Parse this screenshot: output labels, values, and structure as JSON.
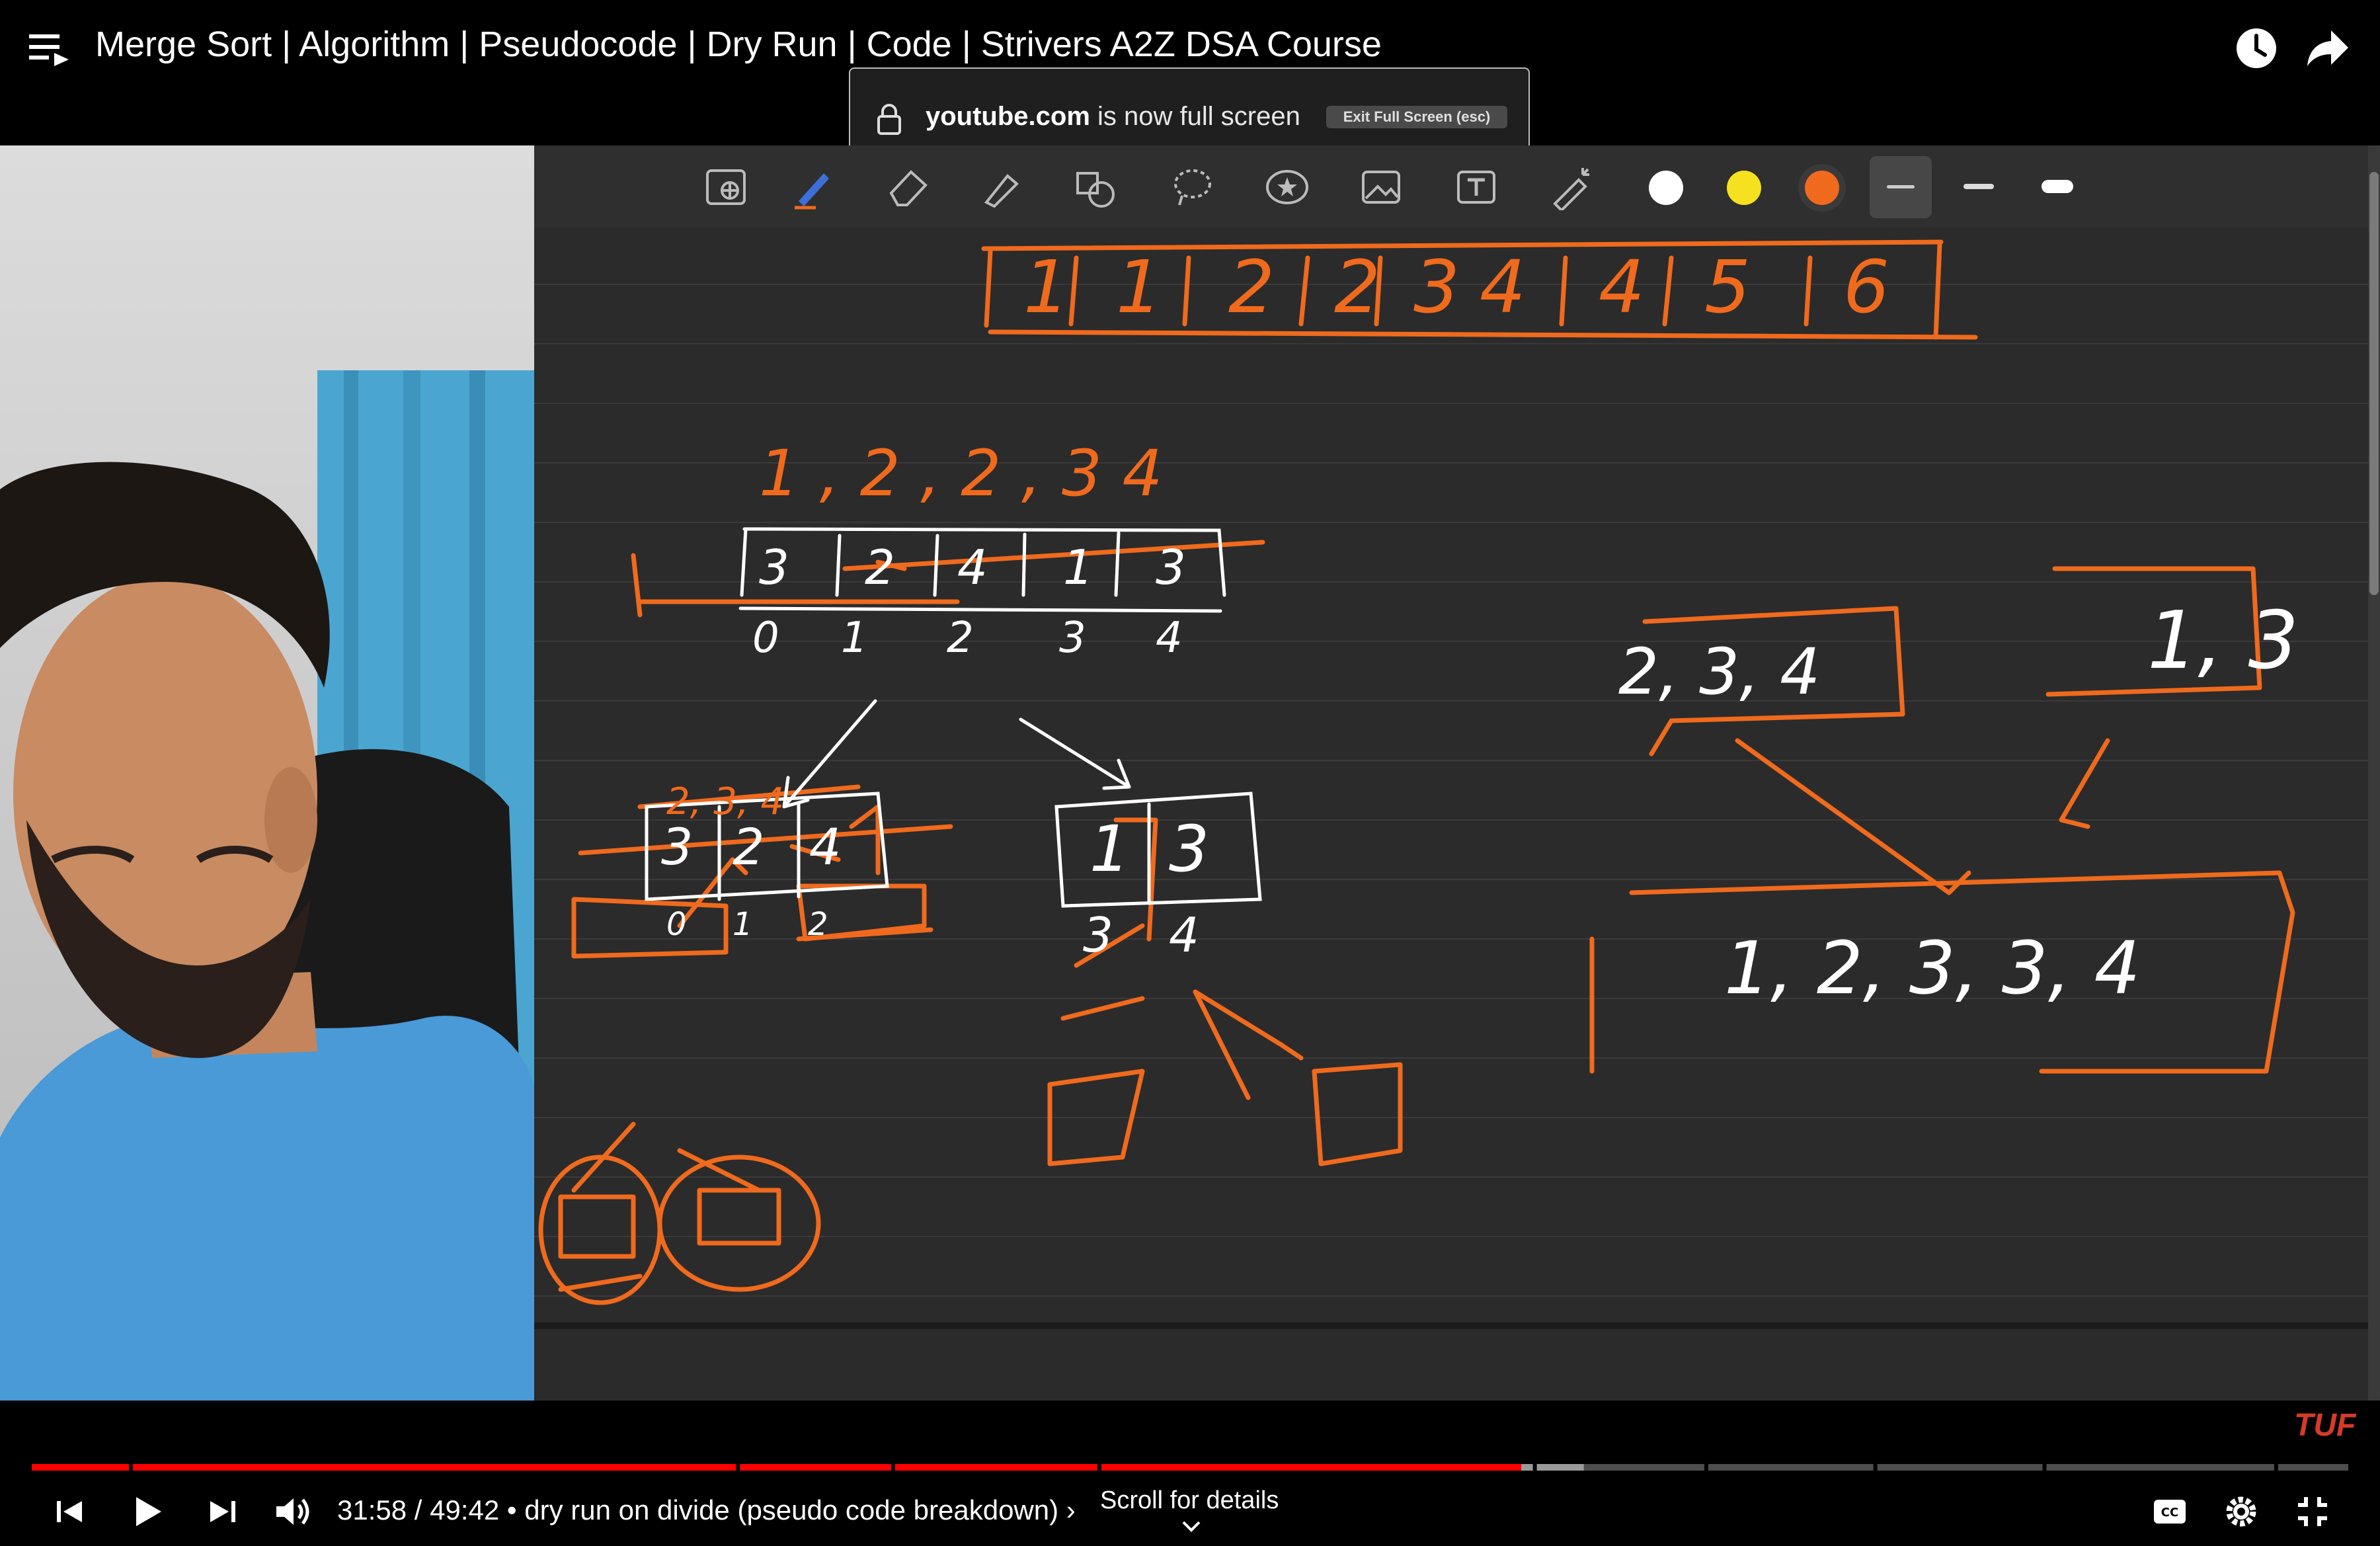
{
  "header": {
    "title": "Merge Sort | Algorithm | Pseudocode | Dry Run | Code | Strivers A2Z DSA Course"
  },
  "fullscreen_notice": {
    "site": "youtube.com",
    "message": "is now full screen",
    "exit_button": "Exit Full Screen (esc)"
  },
  "whiteboard": {
    "merged_row": [
      "1",
      "1",
      "2",
      "2",
      "3",
      "4",
      "4",
      "5",
      "6"
    ],
    "top_numbers": "1 , 2 , 2 , 3  4",
    "array_values": [
      "3",
      "2",
      "4",
      "1",
      "3"
    ],
    "array_indices": [
      "0",
      "1",
      "2",
      "3",
      "4"
    ],
    "left_half_label": "2, 3, 4",
    "left_half_values": [
      "3",
      "2",
      "4"
    ],
    "left_half_indices": [
      "0",
      "1",
      "2"
    ],
    "right_half_values": [
      "1",
      "3"
    ],
    "right_half_indices": [
      "3",
      "4"
    ],
    "left_box_label": "2, 3, 4",
    "right_box_label": "1, 3",
    "merged_box_label": "1, 2, 3, 3, 4",
    "pen_colors": [
      "#ffffff",
      "#f5e11f",
      "#f06a1d"
    ]
  },
  "brand": {
    "logo_text": "TUF"
  },
  "player": {
    "current_time": "31:58",
    "duration": "49:42",
    "chapter": "dry run on divide (pseudo code breakdown)",
    "scroll_hint": "Scroll for details",
    "progress_fraction": 0.643,
    "buffered_fraction": 0.67,
    "accent_color": "#ff0000"
  },
  "icons": {
    "menu": "playlist-menu-icon",
    "watch_later": "clock-icon",
    "share": "share-icon",
    "prev": "previous-icon",
    "play": "play-icon",
    "next": "next-icon",
    "volume": "volume-icon",
    "captions": "captions-icon",
    "settings": "gear-icon",
    "exit_fullscreen": "exit-fullscreen-icon"
  }
}
